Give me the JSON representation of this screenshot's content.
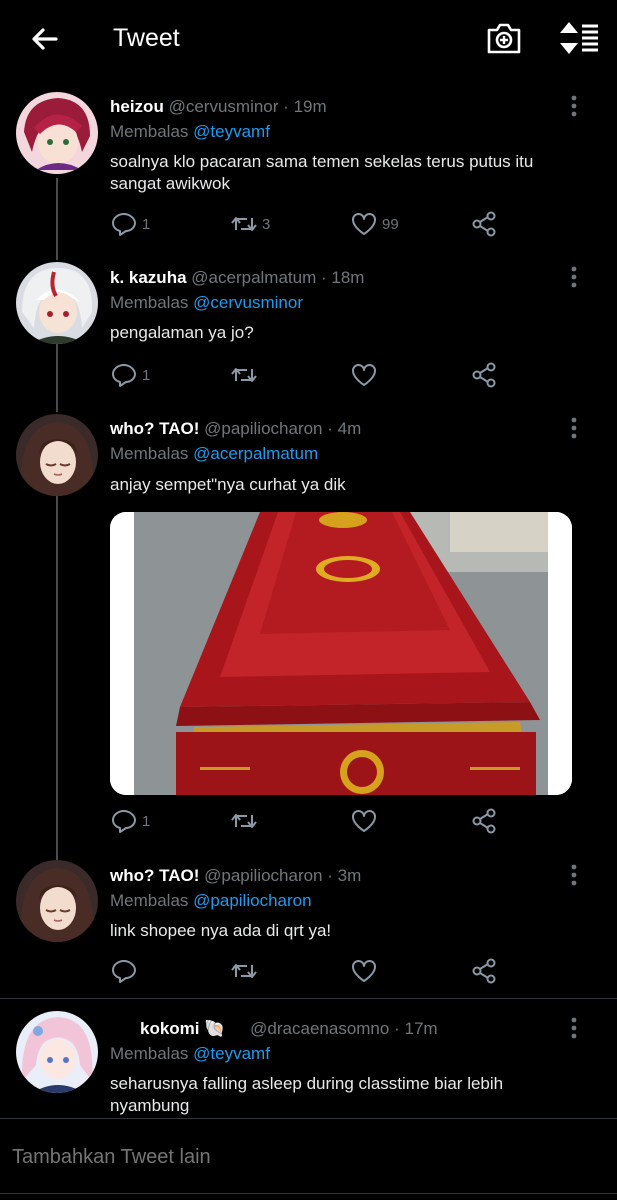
{
  "header": {
    "title": "Tweet",
    "back_icon": "arrow-left-icon",
    "camera_icon": "camera-plus-icon",
    "sort_icon": "sort-icon"
  },
  "colors": {
    "background": "#000000",
    "accent": "#1d9bf0",
    "muted": "#71767b",
    "text": "#e7e9ea"
  },
  "tweets": [
    {
      "name": "heizou",
      "handle": "@cervusminor",
      "sep": "·",
      "time": "19m",
      "reply_prefix": "Membalas",
      "reply_to": "@teyvamf",
      "text": "soalnya klo pacaran sama temen sekelas terus putus itu sangat awikwok",
      "replies": "1",
      "retweets": "3",
      "likes": "99"
    },
    {
      "name": "k. kazuha",
      "handle": "@acerpalmatum",
      "sep": "·",
      "time": "18m",
      "reply_prefix": "Membalas",
      "reply_to": "@cervusminor",
      "text": "pengalaman ya jo?",
      "replies": "1",
      "retweets": "",
      "likes": ""
    },
    {
      "name": "who? TAO!",
      "handle": "@papiliocharon",
      "sep": "·",
      "time": "4m",
      "reply_prefix": "Membalas",
      "reply_to": "@acerpalmatum",
      "text": "anjay sempet\"nya curhat ya dik",
      "replies": "1",
      "retweets": "",
      "likes": ""
    },
    {
      "name": "who? TAO!",
      "handle": "@papiliocharon",
      "sep": "·",
      "time": "3m",
      "reply_prefix": "Membalas",
      "reply_to": "@papiliocharon",
      "text": "link shopee nya ada di qrt ya!",
      "replies": "",
      "retweets": "",
      "likes": ""
    },
    {
      "name": "kokomi",
      "name_emoji": "🐚",
      "handle": "@dracaenasomno",
      "sep": "·",
      "time": "17m",
      "reply_prefix": "Membalas",
      "reply_to": "@teyvamf",
      "text": "seharusnya falling asleep during classtime biar lebih nyambung"
    }
  ],
  "compose": {
    "placeholder": "Tambahkan Tweet lain"
  }
}
